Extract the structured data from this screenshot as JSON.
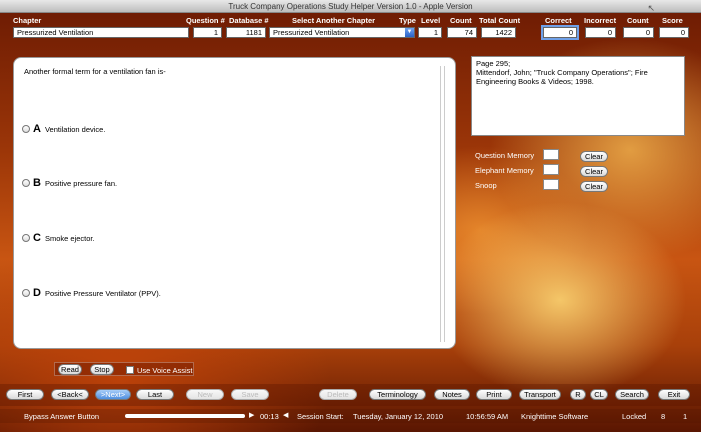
{
  "window": {
    "title": "Truck Company Operations Study Helper Version 1.0 - Apple Version"
  },
  "header": {
    "chapter_label": "Chapter",
    "chapter_value": "Pressurized Ventilation",
    "question_label": "Question #",
    "question_value": "1",
    "database_label": "Database #",
    "database_value": "1181",
    "select_chapter_label": "Select Another Chapter",
    "select_chapter_value": "Pressurized Ventilation",
    "type_label": "Type",
    "type_value": "",
    "level_label": "Level",
    "level_value": "1",
    "count_label": "Count",
    "count_value": "74",
    "total_count_label": "Total Count",
    "total_count_value": "1422",
    "correct_label": "Correct",
    "correct_value": "0",
    "incorrect_label": "Incorrect",
    "incorrect_value": "0",
    "count2_label": "Count",
    "count2_value": "0",
    "score_label": "Score",
    "score_value": "0"
  },
  "question": {
    "text": "Another formal term for a ventilation fan is-",
    "answers": [
      {
        "letter": "A",
        "text": "Ventilation device."
      },
      {
        "letter": "B",
        "text": "Positive pressure fan."
      },
      {
        "letter": "C",
        "text": "Smoke ejector."
      },
      {
        "letter": "D",
        "text": "Positive Pressure Ventilator (PPV)."
      }
    ]
  },
  "reference": {
    "lines": [
      "Page 295;",
      "Mittendorf, John; \"Truck Company Operations\"; Fire",
      "Engineering Books & Videos; 1998."
    ]
  },
  "memory": {
    "items": [
      {
        "label": "Question Memory",
        "button": "Clear"
      },
      {
        "label": "Elephant Memory",
        "button": "Clear"
      },
      {
        "label": "Snoop",
        "button": "Clear"
      }
    ]
  },
  "voice": {
    "read": "Read",
    "stop": "Stop",
    "assist_label": "Use Voice Assist"
  },
  "toolbar": {
    "first": "First",
    "back": "<Back<",
    "next": ">Next>",
    "last": "Last",
    "new": "New",
    "save": "Save",
    "delete": "Delete",
    "terminology": "Terminology",
    "notes": "Notes",
    "print": "Print",
    "transport": "Transport",
    "r": "R",
    "cl": "CL",
    "search": "Search",
    "exit": "Exit"
  },
  "status": {
    "bypass": "Bypass Answer Button",
    "time": "00:13",
    "session": "Session Start:",
    "date": "Tuesday, January 12, 2010",
    "clock": "10:56:59 AM",
    "vendor": "Knighttime Software",
    "locked": "Locked",
    "v1": "8",
    "v2": "1"
  }
}
